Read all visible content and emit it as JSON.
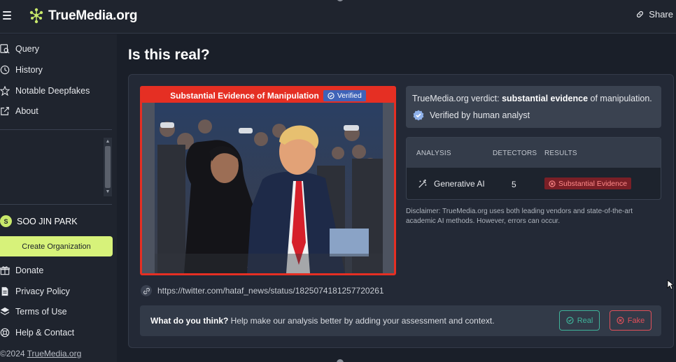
{
  "header": {
    "logo_text": "TrueMedia.org",
    "share_label": "Share"
  },
  "sidebar": {
    "items": [
      {
        "label": "Query",
        "icon": "query-icon"
      },
      {
        "label": "History",
        "icon": "clock-icon"
      },
      {
        "label": "Notable Deepfakes",
        "icon": "star-icon"
      },
      {
        "label": "About",
        "icon": "external-link-icon"
      }
    ],
    "user_name": "SOO JIN PARK",
    "user_initial": "S",
    "create_org_label": "Create Organization",
    "bottom_items": [
      {
        "label": "Donate",
        "icon": "gift-icon"
      },
      {
        "label": "Privacy Policy",
        "icon": "document-icon"
      },
      {
        "label": "Terms of Use",
        "icon": "layers-icon"
      },
      {
        "label": "Help & Contact",
        "icon": "lifebuoy-icon"
      }
    ],
    "copyright_prefix": "©2024 ",
    "copyright_link": "TrueMedia.org"
  },
  "main": {
    "title": "Is this real?",
    "media": {
      "banner_label": "Substantial Evidence of Manipulation",
      "verified_label": "Verified",
      "source_url": "https://twitter.com/hataf_news/status/1825074181257720261"
    },
    "verdict": {
      "prefix": "TrueMedia.org verdict: ",
      "strong": "substantial evidence",
      "suffix": " of manipulation.",
      "human_label": "Verified by human analyst"
    },
    "analysis": {
      "headers": {
        "analysis": "ANALYSIS",
        "detectors": "DETECTORS",
        "results": "RESULTS"
      },
      "row": {
        "name": "Generative AI",
        "detectors": "5",
        "result": "Substantial Evidence"
      }
    },
    "disclaimer": "Disclaimer: TrueMedia.org uses both leading vendors and state-of-the-art academic AI methods. However, errors can occur.",
    "feedback": {
      "question": "What do you think?",
      "prompt": " Help make our analysis better by adding your assessment and context.",
      "real_label": "Real",
      "fake_label": "Fake"
    }
  },
  "colors": {
    "accent_green": "#d7f27a",
    "manipulation_red": "#e52f23",
    "verified_blue": "#3f63b8",
    "real_teal": "#3fb39a",
    "fake_red": "#e0505a"
  }
}
